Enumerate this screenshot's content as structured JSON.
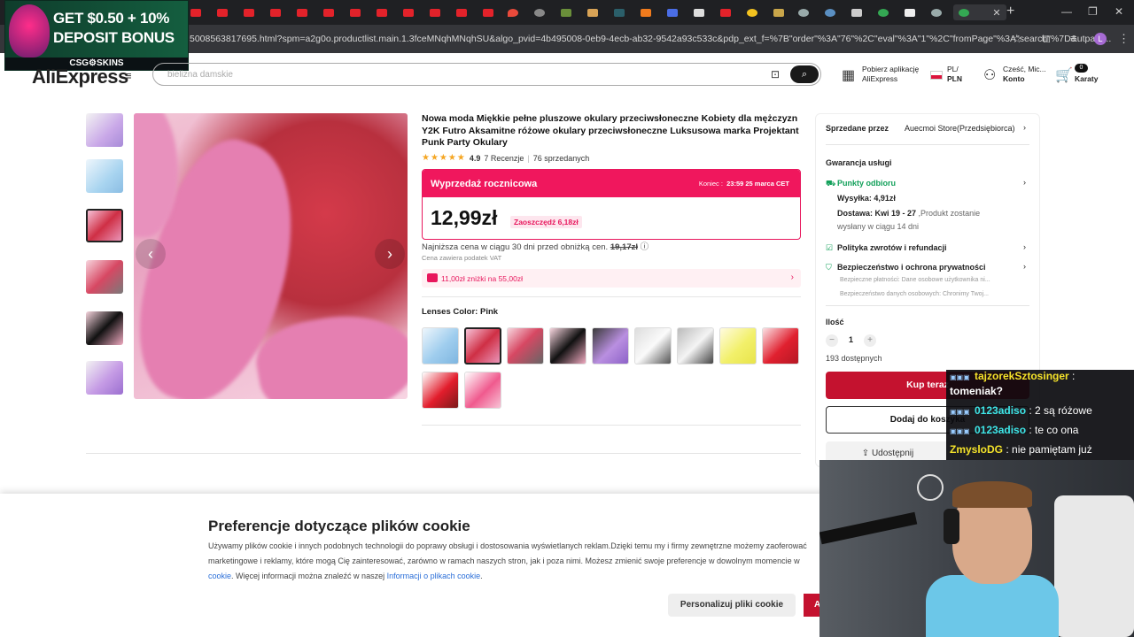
{
  "browser": {
    "url": "5008563817695.html?spm=a2g0o.productlist.main.1.3fceMNqhMNqhSU&algo_pvid=4b495008-0eb9-4ecb-ab32-9542a93c533c&pdp_ext_f=%7B\"order\"%3A\"76\"%2C\"eval\"%3A\"1\"%2C\"fromPage\"%3A\"search\"%7D&utpara...",
    "profile_initial": "L"
  },
  "ad": {
    "line1": "GET $0.50 + 10%",
    "line2": "DEPOSIT BONUS",
    "brand": "CSG⚙SKINS"
  },
  "header": {
    "logo": "AliExpress",
    "search_placeholder": "bielizna damskie",
    "app_line1": "Pobierz aplikację",
    "app_line2": "AliExpress",
    "lang_line1": "PL/",
    "lang_line2": "PLN",
    "account_line1": "Cześć, Mic...",
    "account_line2": "Konto",
    "cart_count": "0",
    "cart_label": "Karaty"
  },
  "product": {
    "title": "Nowa moda Miękkie pełne pluszowe okulary przeciwsłoneczne Kobiety dla mężczyzn Y2K Futro Aksamitne różowe okulary przeciwsłoneczne Luksusowa marka Projektant Punk Party Okulary",
    "stars": "★★★★★",
    "rating": "4.9",
    "reviews": "7 Recenzje",
    "sold": "76 sprzedanych",
    "sale_label": "Wyprzedaż rocznicowa",
    "sale_end_prefix": "Koniec :",
    "sale_end": "23:59 25 marca CET",
    "price": "12,99zł",
    "save": "Zaoszczędź 6,18zł",
    "lowest_text": "Najniższa cena w ciągu 30 dni przed obniżką cen.",
    "lowest_price": "19,17zł",
    "vat": "Cena zawiera podatek VAT",
    "coupon": "11,00zł zniżki na 55,00zł",
    "lens_label": "Lenses Color: Pink"
  },
  "panel": {
    "seller_label": "Sprzedane przez",
    "seller_name": "Auecmoi Store(Przedsiębiorca)",
    "guarantee": "Gwarancja usługi",
    "pickup": "Punkty odbioru",
    "shipping": "Wysyłka: 4,91zł",
    "delivery_bold": "Dostawa: Kwi 19 - 27",
    "delivery_rest": ",Produkt zostanie",
    "delivery_line2": "wysłany w ciągu 14 dni",
    "returns": "Polityka zwrotów i refundacji",
    "security": "Bezpieczeństwo i ochrona prywatności",
    "security_sub1": "Bezpieczne płatności: Dane osobowe użytkownika ni...",
    "security_sub2": "Bezpieczeństwo danych osobowych: Chronimy Twoj...",
    "qty_label": "Ilość",
    "qty": "1",
    "available": "193 dostępnych",
    "buy_now": "Kup teraz",
    "add_cart": "Dodaj do koszyka",
    "share": "Udostępnij"
  },
  "cookie": {
    "title": "Preferencje dotyczące plików cookie",
    "body": "Używamy plików cookie i innych podobnych technologii do poprawy obsługi i dostosowania wyświetlanych reklam.Dzięki temu my i firmy zewnętrzne możemy zaoferować marketingowe i reklamy, które mogą Cię zainteresować, zarówno w ramach naszych stron, jak i poza nimi. Możesz zmienić swoje preferencje w dowolnym momencie w",
    "body_link_start": "cookie",
    "body_mid": ". Więcej informacji można znaleźć w naszej ",
    "policy_link": "Informacji o plikach cookie",
    "personalize": "Personalizuj pliki cookie",
    "accept": "A"
  },
  "chat": [
    {
      "user": "tajzorekSztosinger",
      "msg": " :",
      "color": "#f5e32a"
    },
    {
      "user": "",
      "msg": "tomeniak?",
      "color": "#ffffff"
    },
    {
      "user": "0123adiso",
      "msg": " : 2 są różowe",
      "color": "#3ee6e8"
    },
    {
      "user": "0123adiso",
      "msg": " : te co ona",
      "color": "#3ee6e8"
    },
    {
      "user": "ZmysloDG",
      "msg": " : nie pamiętam już",
      "color": "#f5e32a"
    }
  ]
}
